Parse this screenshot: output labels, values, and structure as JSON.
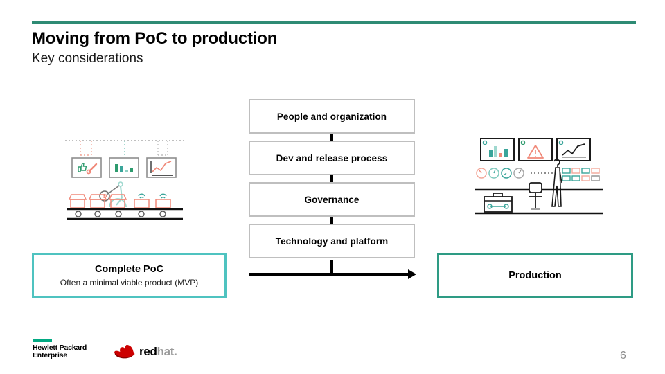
{
  "slide": {
    "title": "Moving from PoC to production",
    "subtitle": "Key considerations",
    "page_number": "6",
    "accent_rule_color": "#2e8b74"
  },
  "flow": {
    "boxes": [
      {
        "label": "People and organization"
      },
      {
        "label": "Dev and release process"
      },
      {
        "label": "Governance"
      },
      {
        "label": "Technology and platform"
      }
    ],
    "box_border_color": "#bfbfbf",
    "connector_color": "#000000",
    "arrow_direction": "right"
  },
  "stages": {
    "start": {
      "title": "Complete PoC",
      "subtitle": "Often a minimal viable product (MVP)",
      "border_color": "#4fc3c0"
    },
    "end": {
      "title": "Production",
      "border_color": "#2e9b84"
    }
  },
  "illustrations": {
    "left": {
      "name": "poc-factory-illustration",
      "elements": [
        "dotted-network-line",
        "panel-thumbs-up-wrench",
        "panel-bar-chart",
        "panel-line-chart",
        "robot-arm",
        "conveyor-belt",
        "open-boxes",
        "closed-boxes-with-signal"
      ]
    },
    "right": {
      "name": "production-operations-illustration",
      "elements": [
        "monitor-bar-chart",
        "monitor-warning-triangle",
        "monitor-line-chart",
        "gauge-dials",
        "dotted-line",
        "operator-person",
        "status-tile-grid",
        "workstation-monitor",
        "toolbox"
      ]
    },
    "accent_colors": {
      "teal": "#3aa59a",
      "salmon": "#f08878",
      "green": "#2e9b6e",
      "gray": "#9a9a9a"
    }
  },
  "footer": {
    "hpe": {
      "wordmark": "Hewlett Packard\nEnterprise",
      "dash_color": "#01a982"
    },
    "redhat": {
      "word_primary": "red",
      "word_secondary": "hat",
      "word_period": ".",
      "hat_color": "#cc0000"
    }
  }
}
